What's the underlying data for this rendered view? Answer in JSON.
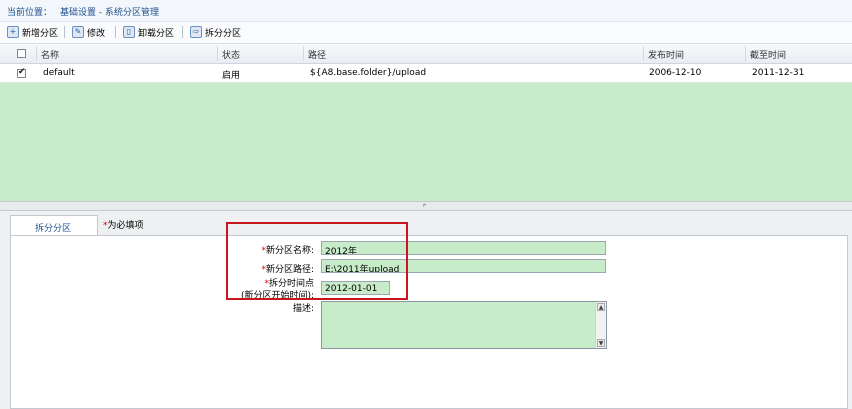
{
  "breadcrumb": {
    "prefix": "当前位置：",
    "path": "基础设置 - 系统分区管理"
  },
  "toolbar": {
    "new_label": "新增分区",
    "edit_label": "修改",
    "unload_label": "卸载分区",
    "split_label": "拆分分区"
  },
  "table": {
    "headers": {
      "name": "名称",
      "status": "状态",
      "path": "路径",
      "publish": "发布时间",
      "expire": "截至时间"
    },
    "rows": [
      {
        "checked": true,
        "name": "default",
        "status": "启用",
        "path": "${A8.base.folder}/upload",
        "publish": "2006-12-10",
        "expire": "2011-12-31"
      }
    ]
  },
  "panel": {
    "tab_label": "拆分分区",
    "required_note_star": "*",
    "required_note": "为必填项",
    "form": {
      "star": "*",
      "name_label": "新分区名称:",
      "name_value": "2012年",
      "path_label": "新分区路径:",
      "path_value": "E:\\2011年upload",
      "split_label_line1": "拆分时间点",
      "split_label_line2": "(新分区开始时间):",
      "split_value": "2012-01-01",
      "desc_label": "描述:",
      "desc_value": ""
    }
  },
  "colors": {
    "grid_bg": "#c8ecc9",
    "highlight": "#c8171c",
    "link": "#1f4f8e"
  }
}
